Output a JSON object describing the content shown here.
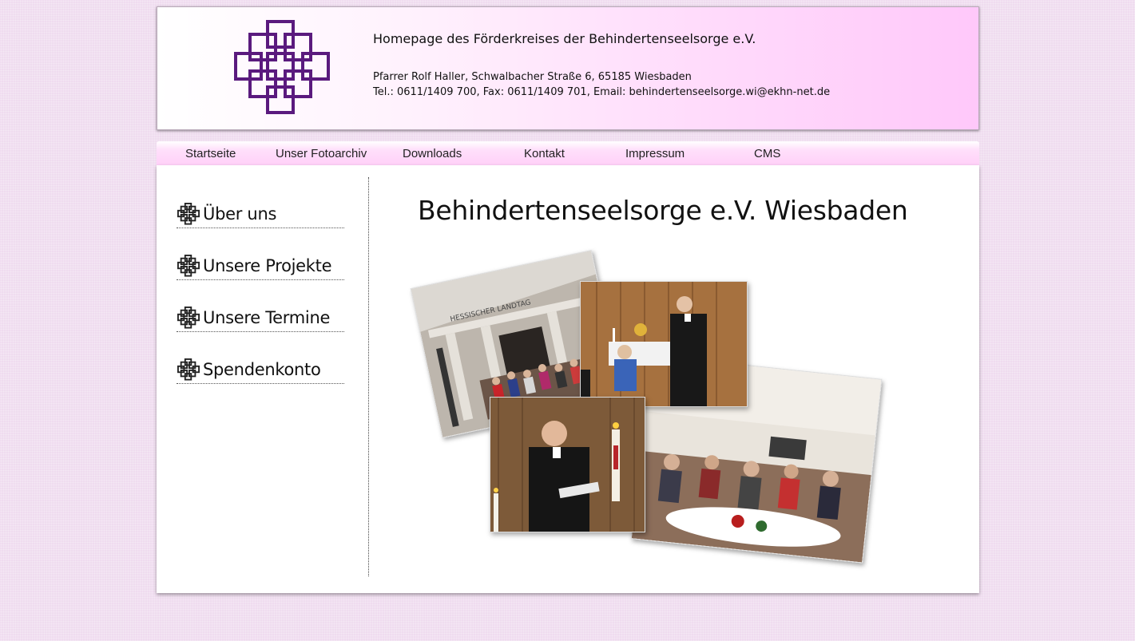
{
  "header": {
    "title": "Homepage des Förderkreises der Behindertenseelsorge e.V.",
    "address_line": "Pfarrer Rolf Haller, Schwalbacher Straße 6, 65185 Wiesbaden",
    "contact_line": "Tel.: 0611/1409 700, Fax: 0611/1409 701, Email: behindertenseelsorge.wi@ekhn-net.de",
    "logo_icon": "cross-logo-icon",
    "logo_color": "#5a1a7e"
  },
  "nav": {
    "items": [
      {
        "label": "Startseite"
      },
      {
        "label": "Unser Fotoarchiv"
      },
      {
        "label": "Downloads"
      },
      {
        "label": "Kontakt"
      },
      {
        "label": "Impressum"
      },
      {
        "label": "CMS"
      }
    ]
  },
  "sidebar": {
    "items": [
      {
        "label": "Über uns"
      },
      {
        "label": "Unsere Projekte"
      },
      {
        "label": "Unsere Termine"
      },
      {
        "label": "Spendenkonto"
      }
    ]
  },
  "main": {
    "heading": "Behindertenseelsorge e.V. Wiesbaden",
    "photo_sign_text": "HESSISCHER LANDTAG"
  }
}
